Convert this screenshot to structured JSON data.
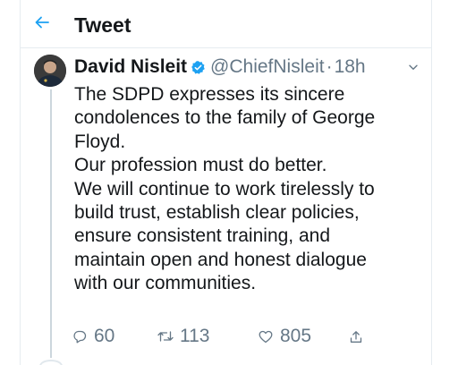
{
  "header": {
    "back_icon": "arrow-left-icon",
    "title": "Tweet"
  },
  "tweet": {
    "author_name": "David Nisleit",
    "verified_icon": "verified-badge-icon",
    "handle": "@ChiefNisleit",
    "separator": "·",
    "time": "18h",
    "menu_icon": "chevron-down-icon",
    "text_lines": [
      "The SDPD expresses its sincere",
      "condolences to the family of George",
      "Floyd.",
      "Our profession must do better.",
      "We will continue to work tirelessly to",
      "build trust, establish clear policies,",
      "ensure consistent training, and",
      "maintain open and honest dialogue",
      "with our communities."
    ],
    "actions": {
      "reply_count": "60",
      "retweet_count": "113",
      "like_count": "805",
      "reply_icon": "reply-bubble-icon",
      "retweet_icon": "retweet-icon",
      "like_icon": "heart-icon",
      "share_icon": "share-icon"
    }
  },
  "colors": {
    "accent": "#1da1f2",
    "text": "#14171a",
    "muted": "#657786",
    "border": "#e6ecf0"
  }
}
